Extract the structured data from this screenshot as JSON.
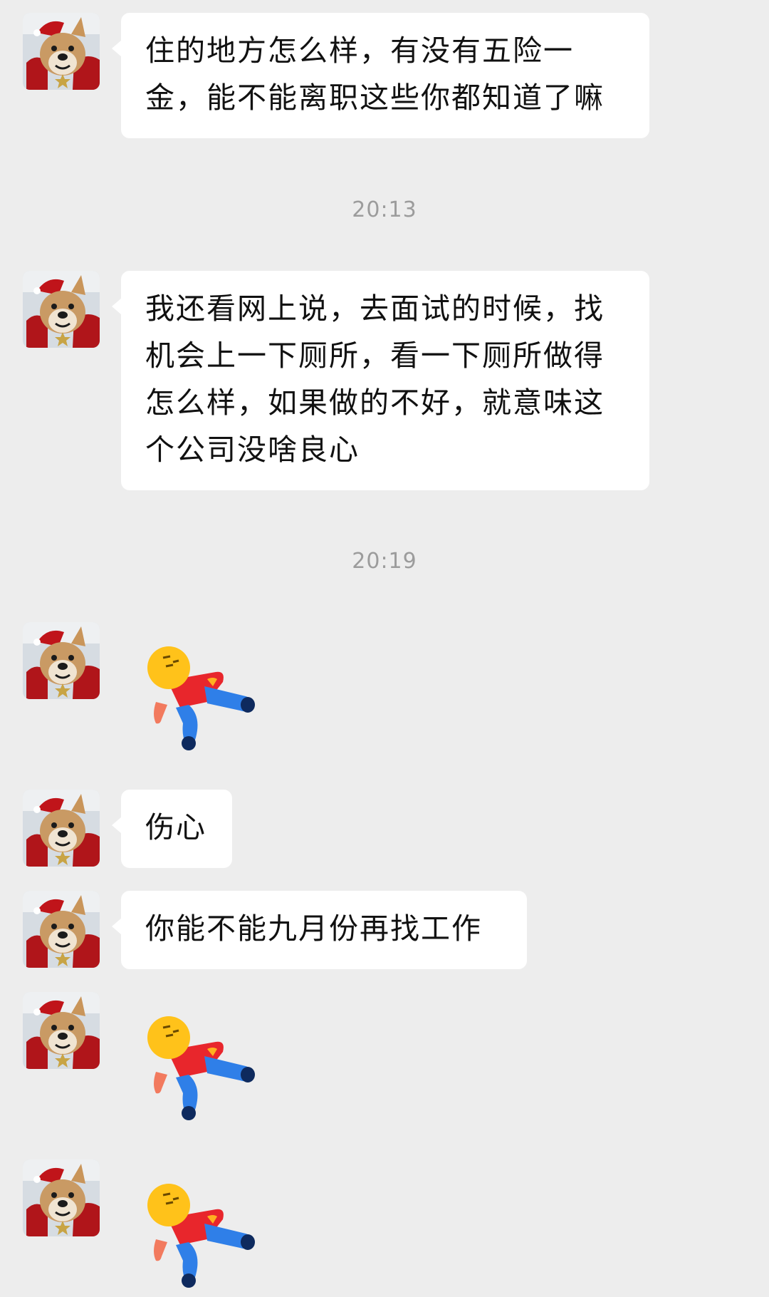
{
  "messages": [
    {
      "type": "text",
      "text": "住的地方怎么样，有没有五险一金，能不能离职这些你都知道了嘛"
    },
    {
      "type": "time",
      "text": "20:13"
    },
    {
      "type": "text",
      "text": "我还看网上说，去面试的时候，找机会上一下厕所，看一下厕所做得怎么样，如果做的不好，就意味这个公司没啥良心"
    },
    {
      "type": "time",
      "text": "20:19"
    },
    {
      "type": "sticker",
      "icon": "lying-down-person-sticker-icon"
    },
    {
      "type": "text",
      "text": "伤心"
    },
    {
      "type": "text",
      "text": "你能不能九月份再找工作"
    },
    {
      "type": "sticker",
      "icon": "lying-down-person-sticker-icon"
    },
    {
      "type": "sticker",
      "icon": "lying-down-person-sticker-icon"
    }
  ],
  "avatar_icon": "shiba-dog-avatar-icon",
  "colors": {
    "background": "#ededed",
    "bubble": "#ffffff",
    "time_text": "#9c9c9c"
  }
}
